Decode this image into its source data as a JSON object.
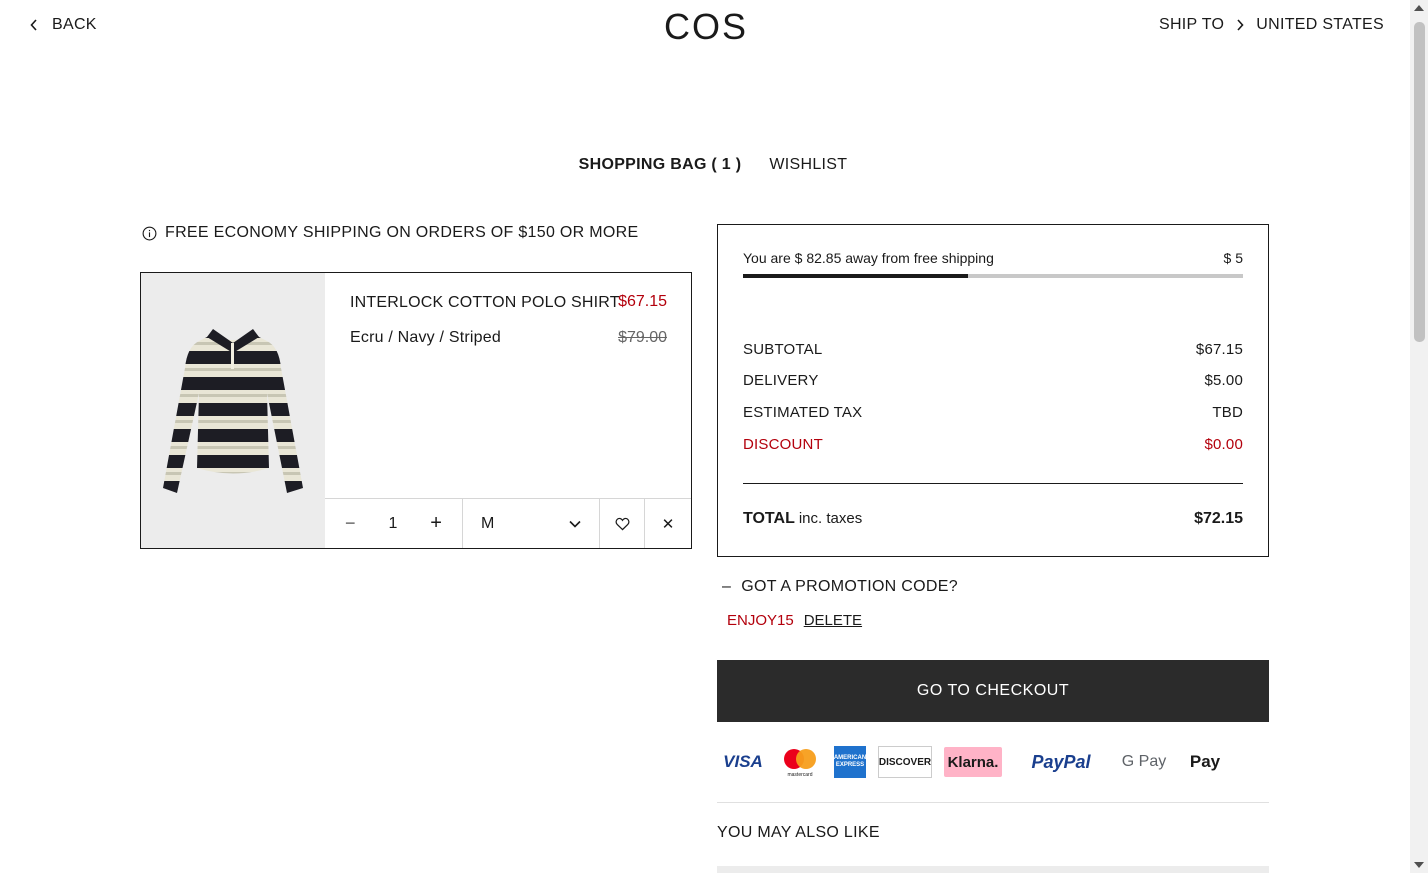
{
  "header": {
    "back_label": "BACK",
    "logo": "COS",
    "ship_to_label": "SHIP TO",
    "country": "UNITED STATES"
  },
  "tabs": {
    "bag": "SHOPPING BAG ( 1 )",
    "wishlist": "WISHLIST"
  },
  "notice": "FREE ECONOMY SHIPPING ON ORDERS OF $150 OR MORE",
  "item": {
    "name": "INTERLOCK COTTON POLO SHIRT",
    "price": "$67.15",
    "original_price": "$79.00",
    "variant": "Ecru / Navy / Striped",
    "quantity": "1",
    "size": "M"
  },
  "summary": {
    "shipping_message": "You are $ 82.85 away from free shipping",
    "shipping_amount": "$ 5",
    "shipping_progress": 0.45,
    "subtotal_label": "SUBTOTAL",
    "subtotal": "$67.15",
    "delivery_label": "DELIVERY",
    "delivery": "$5.00",
    "tax_label": "ESTIMATED TAX",
    "tax": "TBD",
    "discount_label": "DISCOUNT",
    "discount": "$0.00",
    "total_label": "TOTAL",
    "total_suffix": "inc. taxes",
    "total": "$72.15"
  },
  "promo": {
    "toggle_symbol": "–",
    "label": "GOT A PROMOTION CODE?",
    "code": "ENJOY15",
    "delete_label": "DELETE"
  },
  "checkout_label": "GO TO CHECKOUT",
  "payment": {
    "visa": "VISA",
    "mastercard": "mastercard",
    "amex": "AMERICAN EXPRESS",
    "discover": "DISCOVER",
    "klarna": "Klarna.",
    "paypal": "PayPal",
    "gpay": "G Pay",
    "applepay": " Pay"
  },
  "recommendations_title": "YOU MAY ALSO LIKE",
  "colors": {
    "accent_red": "#b3000c",
    "button_dark": "#2b2b2b"
  }
}
